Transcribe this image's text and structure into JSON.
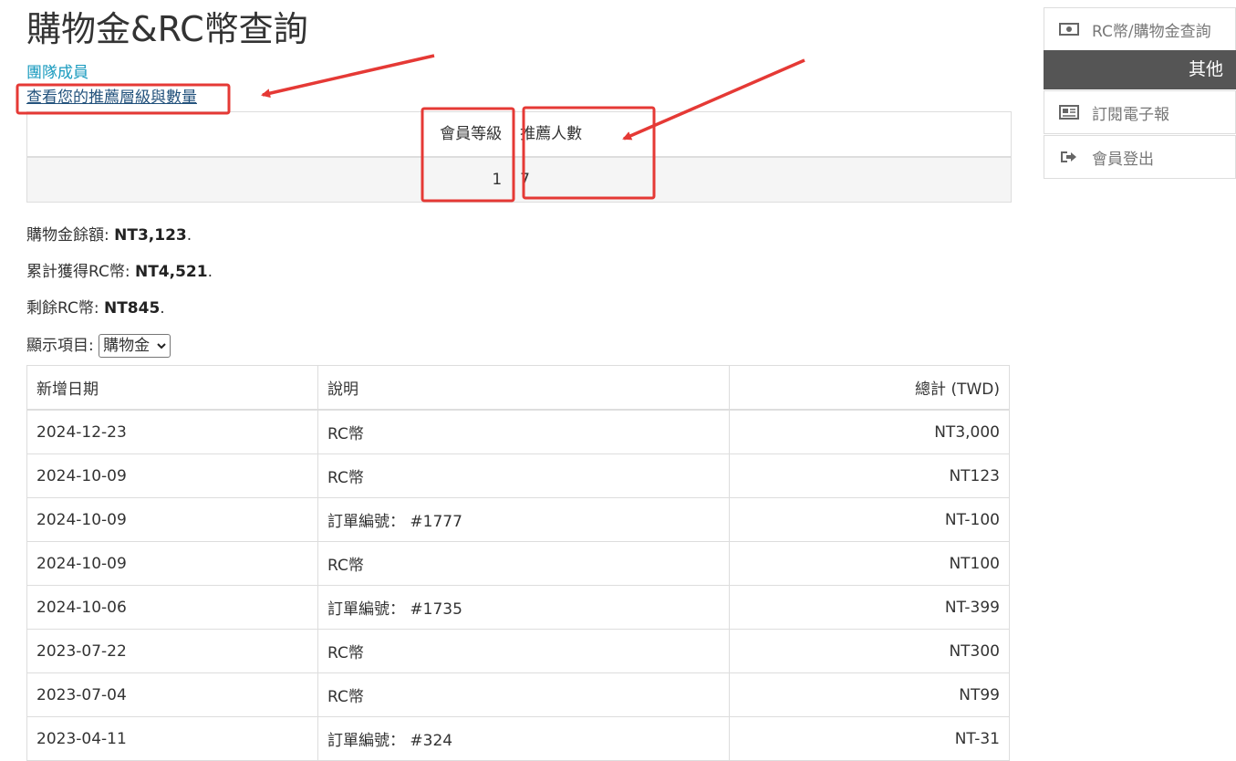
{
  "page": {
    "title": "購物金&RC幣查詢",
    "team_link": "團隊成員",
    "referral_link": "查看您的推薦層級與數量"
  },
  "referral_table": {
    "headers": [
      "會員等級",
      "推薦人數"
    ],
    "row": [
      "1",
      "7"
    ]
  },
  "summary": {
    "shopping_label": "購物金餘額: ",
    "shopping_value": "NT3,123",
    "rc_total_label": "累計獲得RC幣: ",
    "rc_total_value": "NT4,521",
    "rc_remain_label": "剩餘RC幣: ",
    "rc_remain_value": "NT845"
  },
  "filter": {
    "label": "顯示項目:",
    "selected": "購物金"
  },
  "table": {
    "headers": [
      "新增日期",
      "說明",
      "總計 (TWD)"
    ],
    "rows": [
      [
        "2024-12-23",
        "RC幣",
        "NT3,000"
      ],
      [
        "2024-10-09",
        "RC幣",
        "NT123"
      ],
      [
        "2024-10-09",
        "訂單編號： #1777",
        "NT-100"
      ],
      [
        "2024-10-09",
        "RC幣",
        "NT100"
      ],
      [
        "2024-10-06",
        "訂單編號： #1735",
        "NT-399"
      ],
      [
        "2023-07-22",
        "RC幣",
        "NT300"
      ],
      [
        "2023-07-04",
        "RC幣",
        "NT99"
      ],
      [
        "2023-04-11",
        "訂單編號： #324",
        "NT-31"
      ]
    ]
  },
  "sidebar": {
    "items_top": [
      {
        "label": "RC幣/購物金查詢",
        "icon": "money-icon"
      }
    ],
    "section_title": "其他",
    "items_bottom": [
      {
        "label": "訂閱電子報",
        "icon": "newspaper-icon"
      },
      {
        "label": "會員登出",
        "icon": "sign-out-icon"
      }
    ]
  },
  "colors": {
    "link": "#1a9bbf",
    "annotation": "#e53935",
    "sidebar_header": "#555555"
  }
}
